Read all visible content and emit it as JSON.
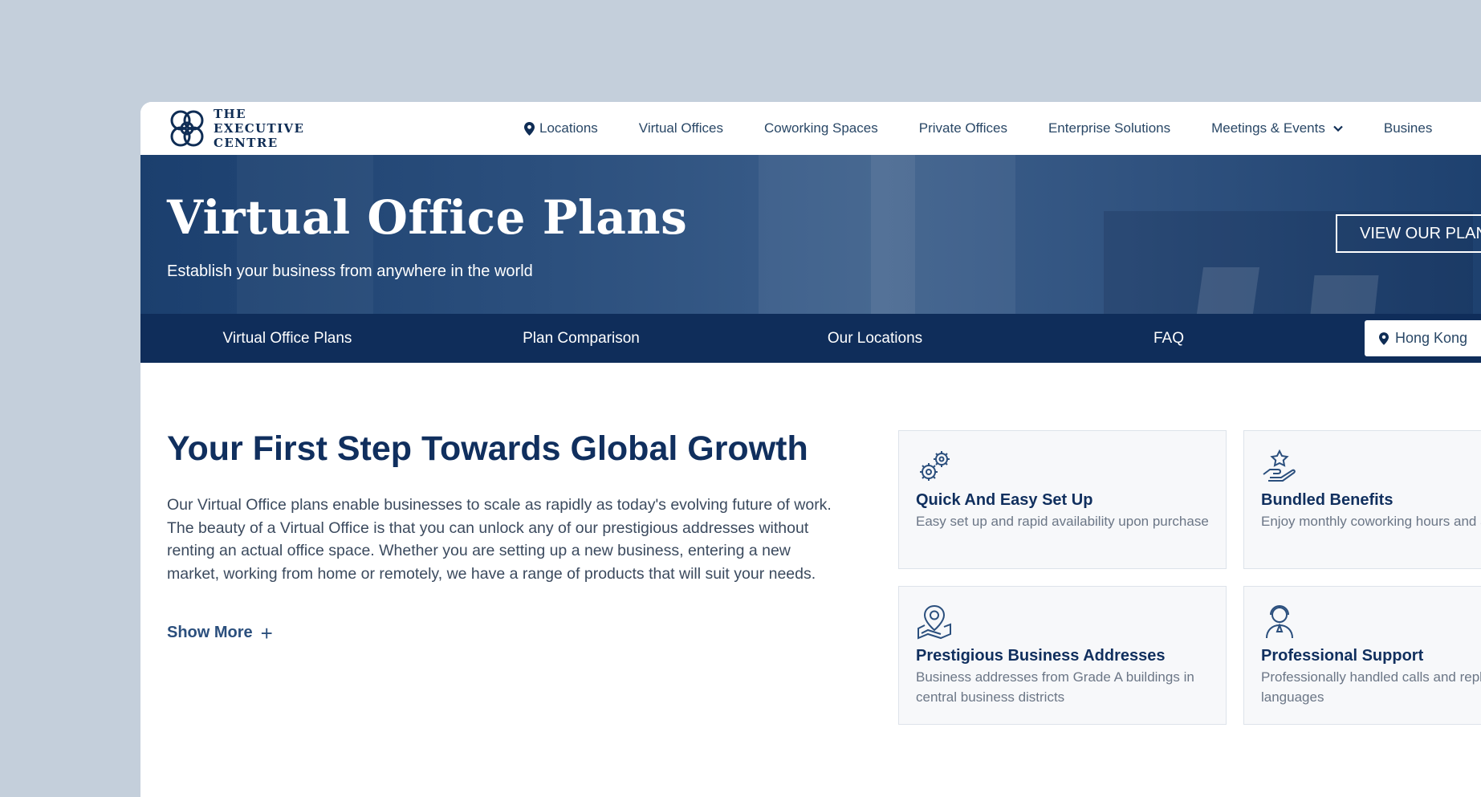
{
  "logo": {
    "line1": "THE",
    "line2": "EXECUTIVE",
    "line3": "CENTRE"
  },
  "nav": {
    "items": [
      "Locations",
      "Virtual Offices",
      "Coworking Spaces",
      "Private Offices",
      "Enterprise Solutions",
      "Meetings & Events",
      "Busines"
    ]
  },
  "hero": {
    "title": "Virtual Office Plans",
    "subtitle": "Establish your business from anywhere in the world",
    "button": "VIEW OUR PLAN"
  },
  "subnav": {
    "items": [
      "Virtual Office Plans",
      "Plan Comparison",
      "Our Locations",
      "FAQ"
    ],
    "location": "Hong Kong"
  },
  "main": {
    "heading": "Your First Step Towards Global Growth",
    "paragraph": "Our Virtual Office plans enable businesses to scale as rapidly as today's evolving future of work. The beauty of a Virtual Office is that you can unlock any of our prestigious addresses without renting an actual office space. Whether you are setting up a new business, entering a new market, working from home or remotely, we have a range of products that will suit your needs.",
    "show_more": "Show More",
    "show_more_icon": "+"
  },
  "cards": [
    {
      "icon": "gears-icon",
      "title": "Quick And Easy Set Up",
      "desc": "Easy set up and rapid availability upon purchase"
    },
    {
      "icon": "hand-star-icon",
      "title": "Bundled Benefits",
      "desc": "Enjoy monthly coworking hours and add-on rates"
    },
    {
      "icon": "map-pin-icon",
      "title": "Prestigious Business Addresses",
      "desc": "Business addresses from Grade A buildings in central business districts"
    },
    {
      "icon": "person-headset-icon",
      "title": "Professional Support",
      "desc": "Professionally handled calls and replies in local languages"
    }
  ],
  "colors": {
    "background": "#c4cfdb",
    "navy": "#0f2d5a",
    "heading": "#102f5e",
    "link": "#294766",
    "text": "#3b4a5e"
  }
}
